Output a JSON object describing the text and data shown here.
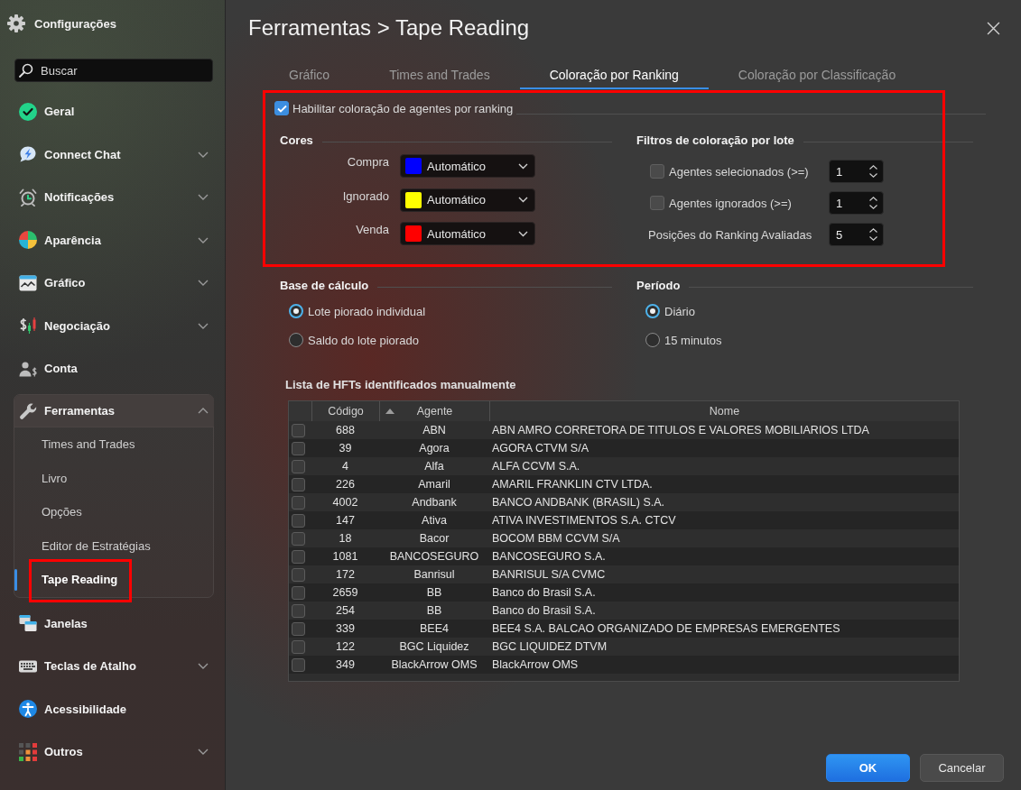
{
  "sidebar": {
    "title": "Configurações",
    "search": {
      "placeholder": "Buscar"
    },
    "items": [
      {
        "label": "Geral",
        "kind": "page"
      },
      {
        "label": "Connect Chat",
        "kind": "group",
        "expanded": false
      },
      {
        "label": "Notificações",
        "kind": "group",
        "expanded": false
      },
      {
        "label": "Aparência",
        "kind": "group",
        "expanded": false
      },
      {
        "label": "Gráfico",
        "kind": "group",
        "expanded": false
      },
      {
        "label": "Negociação",
        "kind": "group",
        "expanded": false
      },
      {
        "label": "Conta",
        "kind": "page"
      },
      {
        "label": "Ferramentas",
        "kind": "group",
        "expanded": true,
        "children": [
          {
            "label": "Times and Trades",
            "selected": false,
            "highlighted": false
          },
          {
            "label": "Livro",
            "selected": false,
            "highlighted": false
          },
          {
            "label": "Opções",
            "selected": false,
            "highlighted": false
          },
          {
            "label": "Editor de Estratégias",
            "selected": false,
            "highlighted": false
          },
          {
            "label": "Tape Reading",
            "selected": true,
            "highlighted": true
          }
        ]
      },
      {
        "label": "Janelas",
        "kind": "page"
      },
      {
        "label": "Teclas de Atalho",
        "kind": "group",
        "expanded": false
      },
      {
        "label": "Acessibilidade",
        "kind": "page"
      },
      {
        "label": "Outros",
        "kind": "group",
        "expanded": false
      }
    ]
  },
  "dialog": {
    "title": "Ferramentas > Tape Reading"
  },
  "tabs": [
    {
      "label": "Gráfico",
      "selected": false
    },
    {
      "label": "Times and Trades",
      "selected": false
    },
    {
      "label": "Coloração por Ranking",
      "selected": true
    },
    {
      "label": "Coloração por Classificação",
      "selected": false
    }
  ],
  "ranking_section": {
    "highlighted": true,
    "enable": {
      "label": "Habilitar coloração de agentes por ranking",
      "checked": true
    },
    "colors": {
      "heading": "Cores",
      "rows": [
        {
          "label": "Compra",
          "color": "#0000ff",
          "value": "Automático"
        },
        {
          "label": "Ignorado",
          "color": "#ffff00",
          "value": "Automático"
        },
        {
          "label": "Venda",
          "color": "#ff0000",
          "value": "Automático"
        }
      ]
    },
    "lot_filters": {
      "heading": "Filtros de coloração por lote",
      "rows": [
        {
          "kind": "checkbox",
          "label": "Agentes selecionados (>=)",
          "checked": false,
          "value": "1"
        },
        {
          "kind": "checkbox",
          "label": "Agentes ignorados (>=)",
          "checked": false,
          "value": "1"
        },
        {
          "kind": "plain",
          "label": "Posições do Ranking Avaliadas",
          "value": "5"
        }
      ]
    }
  },
  "calculation_base": {
    "heading": "Base de cálculo",
    "options": [
      {
        "label": "Lote piorado individual",
        "selected": true
      },
      {
        "label": "Saldo do lote piorado",
        "selected": false
      }
    ]
  },
  "period": {
    "heading": "Período",
    "options": [
      {
        "label": "Diário",
        "selected": true
      },
      {
        "label": "15 minutos",
        "selected": false
      }
    ]
  },
  "hft_list": {
    "title": "Lista de HFTs identificados manualmente",
    "columns": [
      {
        "label": "Código",
        "sorted": false
      },
      {
        "label": "Agente",
        "sorted": true
      },
      {
        "label": "Nome",
        "sorted": false
      }
    ],
    "rows": [
      {
        "checked": false,
        "code": "688",
        "agent": "ABN",
        "name": "ABN AMRO CORRETORA DE TITULOS E VALORES MOBILIARIOS LTDA"
      },
      {
        "checked": false,
        "code": "39",
        "agent": "Agora",
        "name": "AGORA CTVM S/A"
      },
      {
        "checked": false,
        "code": "4",
        "agent": "Alfa",
        "name": "ALFA CCVM S.A."
      },
      {
        "checked": false,
        "code": "226",
        "agent": "Amaril",
        "name": "AMARIL FRANKLIN CTV LTDA."
      },
      {
        "checked": false,
        "code": "4002",
        "agent": "Andbank",
        "name": "BANCO ANDBANK (BRASIL) S.A."
      },
      {
        "checked": false,
        "code": "147",
        "agent": "Ativa",
        "name": "ATIVA INVESTIMENTOS S.A. CTCV"
      },
      {
        "checked": false,
        "code": "18",
        "agent": "Bacor",
        "name": "BOCOM BBM CCVM S/A"
      },
      {
        "checked": false,
        "code": "1081",
        "agent": "BANCOSEGURO",
        "name": "BANCOSEGURO S.A."
      },
      {
        "checked": false,
        "code": "172",
        "agent": "Banrisul",
        "name": "BANRISUL S/A CVMC"
      },
      {
        "checked": false,
        "code": "2659",
        "agent": "BB",
        "name": "Banco do Brasil S.A."
      },
      {
        "checked": false,
        "code": "254",
        "agent": "BB",
        "name": "Banco do Brasil S.A."
      },
      {
        "checked": false,
        "code": "339",
        "agent": "BEE4",
        "name": "BEE4 S.A. BALCAO ORGANIZADO DE EMPRESAS EMERGENTES"
      },
      {
        "checked": false,
        "code": "122",
        "agent": "BGC Liquidez",
        "name": "BGC LIQUIDEZ DTVM"
      },
      {
        "checked": false,
        "code": "349",
        "agent": "BlackArrow OMS",
        "name": "BlackArrow OMS"
      }
    ]
  },
  "buttons": [
    {
      "label": "OK",
      "kind": "primary"
    },
    {
      "label": "Cancelar",
      "kind": "secondary"
    }
  ]
}
